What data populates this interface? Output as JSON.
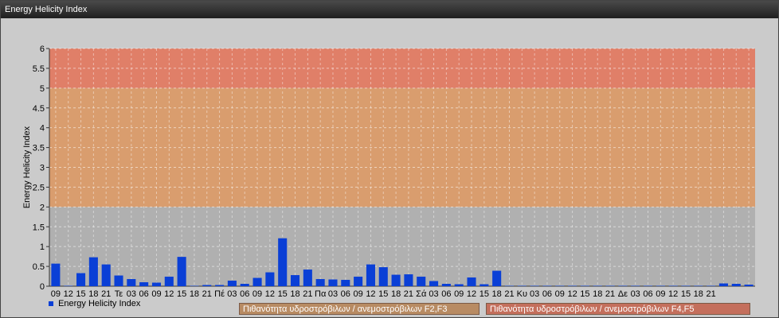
{
  "window": {
    "title": "Energy Helicity Index"
  },
  "legend": {
    "series_label": "Energy Helicity Index",
    "band1_label": "Πιθανότητα υδροστρόβιλων / ανεμοστρόβιλων F2,F3",
    "band2_label": "Πιθανότητα υδροστρόβιλων / ανεμοστρόβιλων F4,F5"
  },
  "colors": {
    "bar": "#0a3fd6",
    "band_low": "#b0b0b0",
    "band_mid": "#d99a68",
    "band_high": "#e07a62",
    "background": "#cbcbcb"
  },
  "chart_data": {
    "type": "bar",
    "ylabel": "Energy Helicity Index",
    "ylim": [
      0,
      6
    ],
    "yticks": [
      "0",
      "0.5",
      "1",
      "1.5",
      "2",
      "2.5",
      "3",
      "3.5",
      "4",
      "4.5",
      "5",
      "5.5",
      "6"
    ],
    "bands": [
      {
        "from": 2,
        "to": 5,
        "label": "Πιθανότητα υδροστρόβιλων / ανεμοστρόβιλων F2,F3"
      },
      {
        "from": 5,
        "to": 6,
        "label": "Πιθανότητα υδροστρόβιλων / ανεμοστρόβιλων F4,F5"
      }
    ],
    "grid": true,
    "series": [
      {
        "name": "Energy Helicity Index",
        "values": [
          0.57,
          0.01,
          0.33,
          0.73,
          0.55,
          0.27,
          0.18,
          0.1,
          0.09,
          0.24,
          0.74,
          0.01,
          0.03,
          0.03,
          0.14,
          0.06,
          0.21,
          0.35,
          1.21,
          0.28,
          0.42,
          0.18,
          0.17,
          0.16,
          0.24,
          0.55,
          0.48,
          0.29,
          0.3,
          0.24,
          0.13,
          0.06,
          0.05,
          0.22,
          0.05,
          0.39,
          0.01,
          0.01,
          0.01,
          0.01,
          0.01,
          0.01,
          0.01,
          0.01,
          0.01,
          0.01,
          0.01,
          0.01,
          0.01,
          0.01,
          0.01,
          0.01,
          0.01,
          0.07,
          0.06,
          0.04
        ]
      }
    ],
    "categories": [
      "09",
      "12",
      "15",
      "18",
      "21",
      "Τε",
      "03",
      "06",
      "09",
      "12",
      "15",
      "18",
      "21",
      "Πέ",
      "03",
      "06",
      "09",
      "12",
      "15",
      "18",
      "21",
      "Πα",
      "03",
      "06",
      "09",
      "12",
      "15",
      "18",
      "21",
      "Σά",
      "03",
      "06",
      "09",
      "12",
      "15",
      "18",
      "21",
      "Κυ",
      "03",
      "06",
      "09",
      "12",
      "15",
      "18",
      "21",
      "Δε",
      "03",
      "06",
      "09",
      "12",
      "15",
      "18",
      "21",
      "",
      "",
      ""
    ]
  }
}
